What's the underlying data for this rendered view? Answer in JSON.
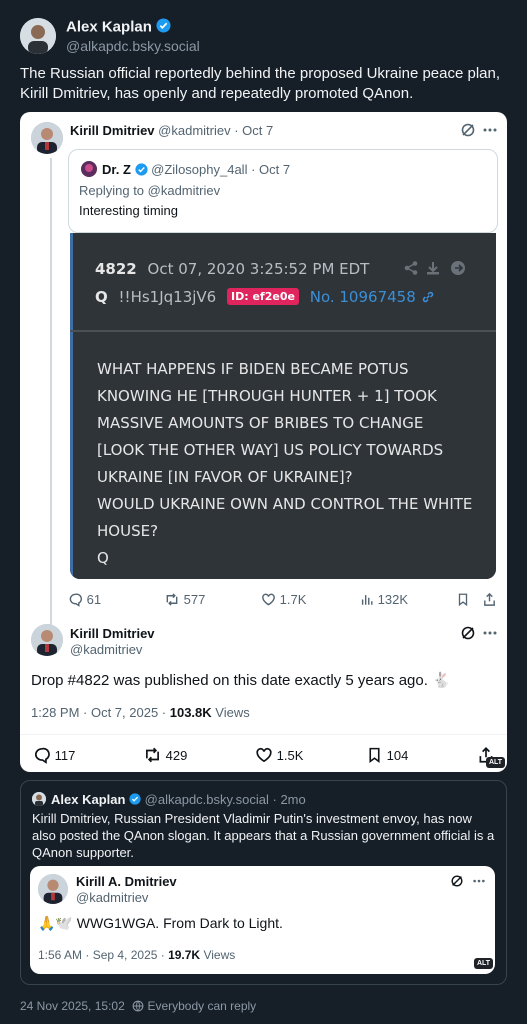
{
  "main_post": {
    "author_name": "Alex Kaplan",
    "author_handle": "@alkapdc.bsky.social",
    "text": "The Russian official reportedly behind the proposed Ukraine peace plan, Kirill Dmitriev, has openly and repeatedly promoted QAnon.",
    "footer_date": "24 Nov 2025, 15:02",
    "footer_reply": "Everybody can reply"
  },
  "tweet1": {
    "author_name": "Kirill Dmitriev",
    "author_handle": "@kadmitriev · Oct 7",
    "quoted": {
      "author_name": "Dr. Z",
      "author_handle": "@Zilosophy_4all · Oct 7",
      "replying_to": "Replying to @kadmitriev",
      "text": "Interesting timing",
      "image": {
        "post_number": "4822",
        "post_date": "Oct 07, 2020 3:25:52 PM EDT",
        "q_label": "Q",
        "tripcode": "!!Hs1Jq13jV6",
        "id_badge": "ID: ef2e0e",
        "post_no": "No. 10967458",
        "body_lines": [
          "WHAT HAPPENS IF BIDEN BECAME POTUS",
          "KNOWING HE [THROUGH HUNTER + 1] TOOK",
          "MASSIVE AMOUNTS OF BRIBES TO CHANGE",
          "[LOOK THE OTHER WAY] US POLICY TOWARDS",
          "UKRAINE [IN FAVOR OF UKRAINE]?",
          "WOULD UKRAINE OWN AND CONTROL THE WHITE",
          "HOUSE?",
          "Q"
        ]
      }
    },
    "stats": {
      "replies": "61",
      "reposts": "577",
      "likes": "1.7K",
      "views": "132K"
    }
  },
  "tweet2": {
    "author_name": "Kirill Dmitriev",
    "author_handle": "@kadmitriev",
    "text": "Drop #4822 was published on this date exactly 5 years ago. 🐇",
    "time": "1:28 PM · Oct 7, 2025 · ",
    "views_count": "103.8K",
    "views_label": " Views",
    "stats": {
      "replies": "117",
      "reposts": "429",
      "likes": "1.5K",
      "bookmarks": "104"
    },
    "alt": "ALT"
  },
  "quote2": {
    "author_name": "Alex Kaplan",
    "author_handle": "@alkapdc.bsky.social · 2mo",
    "text": "Kirill Dmitriev, Russian President Vladimir Putin's investment envoy, has now also posted the QAnon slogan. It appears that a Russian government official is a QAnon supporter.",
    "embedded": {
      "author_name": "Kirill A. Dmitriev",
      "author_handle": "@kadmitriev",
      "text": "🙏🕊️ WWG1WGA. From Dark to Light.",
      "time": "1:56 AM · Sep 4, 2025 · ",
      "views_count": "19.7K",
      "views_label": " Views",
      "alt": "ALT"
    }
  },
  "colors": {
    "background": "#161e27",
    "verified": "#1d9bf0",
    "id_badge": "#e0245e",
    "post_no": "#3b8fd6"
  }
}
